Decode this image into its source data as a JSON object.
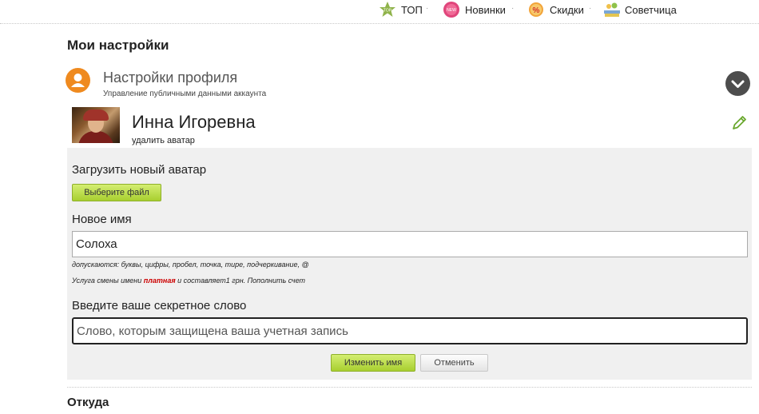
{
  "nav": {
    "items": [
      {
        "label": "ТОП",
        "icon": "top-star-icon"
      },
      {
        "label": "Новинки",
        "icon": "new-badge-icon"
      },
      {
        "label": "Скидки",
        "icon": "discount-percent-icon"
      },
      {
        "label": "Советчица",
        "icon": "advisor-books-icon"
      }
    ],
    "separator": "·"
  },
  "page": {
    "title": "Мои настройки"
  },
  "profile": {
    "title": "Настройки профиля",
    "subtitle": "Управление публичными данными аккаунта",
    "user_name": "Инна Игоревна",
    "delete_avatar": "удалить аватар"
  },
  "form": {
    "upload_label": "Загрузить новый аватар",
    "choose_file": "Выберите файл",
    "new_name_label": "Новое имя",
    "new_name_value": "Солоха",
    "hint_allowed": "допускаются: буквы, цифры, пробел, точка, тире, подчеркивание, @",
    "hint_service_pre": "Услуга смены имени",
    "hint_service_paid": "платная",
    "hint_service_post": "и составляет1 грн. Пополнить счет",
    "secret_label": "Введите ваше секретное слово",
    "secret_placeholder": "Слово, которым защищена ваша учетная запись",
    "submit": "Изменить имя",
    "cancel": "Отменить"
  },
  "next_section": {
    "title": "Откуда"
  },
  "colors": {
    "accent_orange": "#ef8a1f",
    "button_green": "#a8cf2f",
    "paid_red": "#cc0000"
  }
}
